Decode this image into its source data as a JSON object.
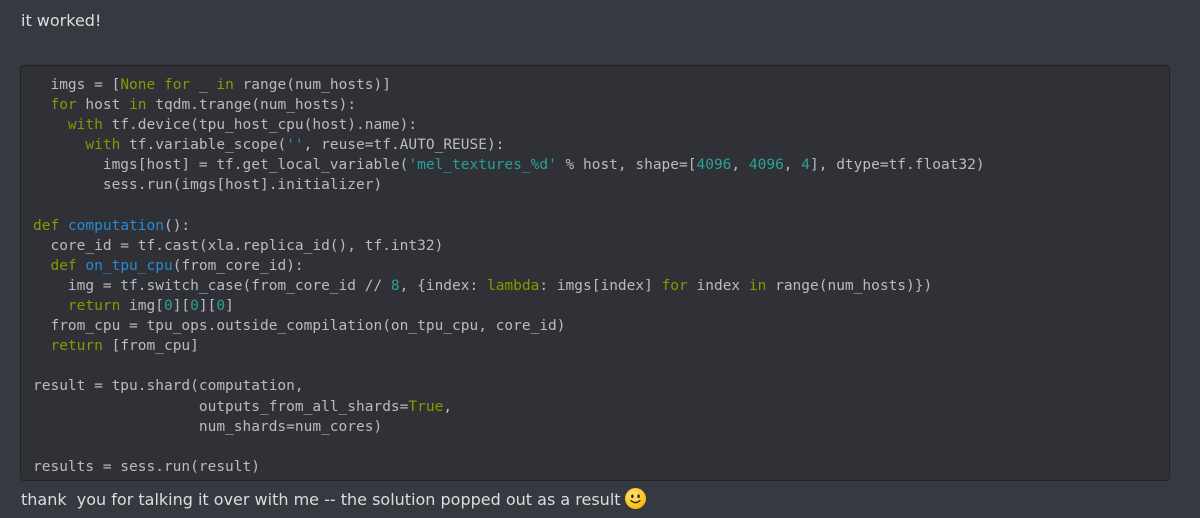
{
  "messages": {
    "first": "it worked!",
    "second": "thank  you for talking it over with me -- the solution popped out as a result"
  },
  "emoji": {
    "name": "slightly-smiling-face",
    "color": "#fcc21b"
  },
  "code_block": {
    "language": "python",
    "lines": [
      [
        [
          "t",
          "  imgs = ["
        ],
        [
          "kw",
          "None"
        ],
        [
          "t",
          " "
        ],
        [
          "kw",
          "for"
        ],
        [
          "t",
          " _ "
        ],
        [
          "kw",
          "in"
        ],
        [
          "t",
          " range(num_hosts)]"
        ]
      ],
      [
        [
          "t",
          "  "
        ],
        [
          "kw",
          "for"
        ],
        [
          "t",
          " host "
        ],
        [
          "kw",
          "in"
        ],
        [
          "t",
          " tqdm.trange(num_hosts):"
        ]
      ],
      [
        [
          "t",
          "    "
        ],
        [
          "kw",
          "with"
        ],
        [
          "t",
          " tf.device(tpu_host_cpu(host).name):"
        ]
      ],
      [
        [
          "t",
          "      "
        ],
        [
          "kw",
          "with"
        ],
        [
          "t",
          " tf.variable_scope("
        ],
        [
          "str",
          "''"
        ],
        [
          "t",
          ", reuse=tf.AUTO_REUSE):"
        ]
      ],
      [
        [
          "t",
          "        imgs[host] = tf.get_local_variable("
        ],
        [
          "str",
          "'mel_textures_%d'"
        ],
        [
          "t",
          " % host, shape=["
        ],
        [
          "num",
          "4096"
        ],
        [
          "t",
          ", "
        ],
        [
          "num",
          "4096"
        ],
        [
          "t",
          ", "
        ],
        [
          "num",
          "4"
        ],
        [
          "t",
          "], dtype=tf.float32)"
        ]
      ],
      [
        [
          "t",
          "        sess.run(imgs[host].initializer)"
        ]
      ],
      [],
      [
        [
          "kw",
          "def"
        ],
        [
          "t",
          " "
        ],
        [
          "fn",
          "computation"
        ],
        [
          "t",
          "():"
        ]
      ],
      [
        [
          "t",
          "  core_id = tf.cast(xla.replica_id(), tf.int32)"
        ]
      ],
      [
        [
          "t",
          "  "
        ],
        [
          "kw",
          "def"
        ],
        [
          "t",
          " "
        ],
        [
          "fn",
          "on_tpu_cpu"
        ],
        [
          "t",
          "(from_core_id):"
        ]
      ],
      [
        [
          "t",
          "    img = tf.switch_case(from_core_id // "
        ],
        [
          "num",
          "8"
        ],
        [
          "t",
          ", {index: "
        ],
        [
          "kw",
          "lambda"
        ],
        [
          "t",
          ": imgs[index] "
        ],
        [
          "kw",
          "for"
        ],
        [
          "t",
          " index "
        ],
        [
          "kw",
          "in"
        ],
        [
          "t",
          " range(num_hosts)})"
        ]
      ],
      [
        [
          "t",
          "    "
        ],
        [
          "kw",
          "return"
        ],
        [
          "t",
          " img["
        ],
        [
          "num",
          "0"
        ],
        [
          "t",
          "]["
        ],
        [
          "num",
          "0"
        ],
        [
          "t",
          "]["
        ],
        [
          "num",
          "0"
        ],
        [
          "t",
          "]"
        ]
      ],
      [
        [
          "t",
          "  from_cpu = tpu_ops.outside_compilation(on_tpu_cpu, core_id)"
        ]
      ],
      [
        [
          "t",
          "  "
        ],
        [
          "kw",
          "return"
        ],
        [
          "t",
          " [from_cpu]"
        ]
      ],
      [],
      [
        [
          "t",
          "result = tpu.shard(computation,"
        ]
      ],
      [
        [
          "t",
          "                   outputs_from_all_shards="
        ],
        [
          "kw",
          "True"
        ],
        [
          "t",
          ","
        ]
      ],
      [
        [
          "t",
          "                   num_shards=num_cores)"
        ]
      ],
      [],
      [
        [
          "t",
          "results = sess.run(result)"
        ]
      ]
    ]
  },
  "colors": {
    "background": "#36393f",
    "code_background": "#2f3136",
    "text": "#dcddde",
    "keyword": "#859900",
    "function": "#268bd2",
    "string_number": "#2aa198"
  }
}
